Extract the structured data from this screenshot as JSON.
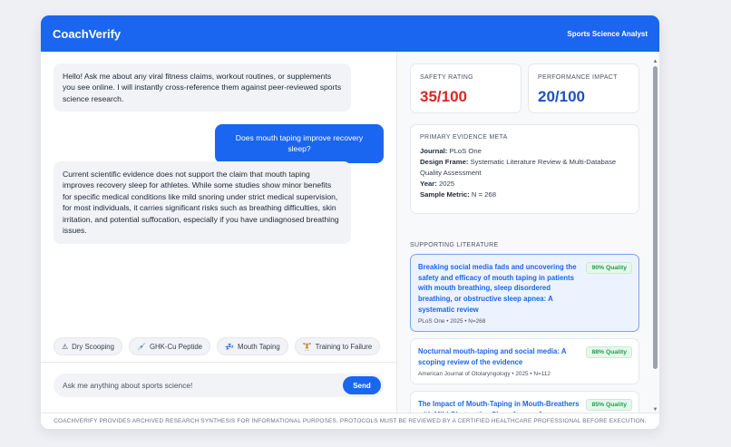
{
  "header": {
    "brand": "CoachVerify",
    "role": "Sports Science Analyst"
  },
  "chat": {
    "messages": [
      {
        "sender": "ai",
        "text": "Hello! Ask me about any viral fitness claims, workout routines, or supplements you see online. I will instantly cross-reference them against peer-reviewed sports science research."
      },
      {
        "sender": "user",
        "text": "Does mouth taping improve recovery sleep?"
      },
      {
        "sender": "ai",
        "text": "Current scientific evidence does not support the claim that mouth taping improves recovery sleep for athletes. While some studies show minor benefits for specific medical conditions like mild snoring under strict medical supervision, for most individuals, it carries significant risks such as breathing difficulties, skin irritation, and potential suffocation, especially if you have undiagnosed breathing issues."
      }
    ],
    "suggestions": [
      {
        "icon": "warning-icon",
        "glyph": "⚠",
        "label": "Dry Scooping"
      },
      {
        "icon": "syringe-icon",
        "glyph": "💉",
        "label": "GHK-Cu Peptide"
      },
      {
        "icon": "sleep-icon",
        "glyph": "💤",
        "label": "Mouth Taping"
      },
      {
        "icon": "dumbbell-icon",
        "glyph": "🏋",
        "label": "Training to Failure"
      }
    ],
    "input_placeholder": "Ask me anything about sports science!",
    "send_label": "Send"
  },
  "panel": {
    "safety": {
      "label": "SAFETY RATING",
      "value": "35/100",
      "color": "#dc2626"
    },
    "performance": {
      "label": "PERFORMANCE IMPACT",
      "value": "20/100",
      "color": "#1e4fc2"
    },
    "meta": {
      "title": "PRIMARY EVIDENCE META",
      "journal_label": "Journal:",
      "journal": "PLoS One",
      "design_label": "Design Frame:",
      "design": "Systematic Literature Review & Multi-Database Quality Assessment",
      "year_label": "Year:",
      "year": "2025",
      "sample_label": "Sample Metric:",
      "sample": "N = 268"
    },
    "literature_title": "SUPPORTING LITERATURE",
    "literature": [
      {
        "title": "Breaking social media fads and uncovering the safety and efficacy of mouth taping in patients with mouth breathing, sleep disordered breathing, or obstructive sleep apnea: A systematic review",
        "meta": "PLoS One • 2025 • N=268",
        "quality": "90% Quality"
      },
      {
        "title": "Nocturnal mouth-taping and social media: A scoping review of the evidence",
        "meta": "American Journal of Otolaryngology • 2025 • N=112",
        "quality": "88% Quality"
      },
      {
        "title": "The Impact of Mouth-Taping in Mouth-Breathers with Mild Obstructive Sleep Apnea: A Preliminary Study",
        "meta": "",
        "quality": "85% Quality"
      }
    ]
  },
  "footer": {
    "disclaimer": "COACHVERIFY PROVIDES ARCHIVED RESEARCH SYNTHESIS FOR INFORMATIONAL PURPOSES. PROTOCOLS MUST BE REVIEWED BY A CERTIFIED HEALTHCARE PROFESSIONAL BEFORE EXECUTION."
  }
}
